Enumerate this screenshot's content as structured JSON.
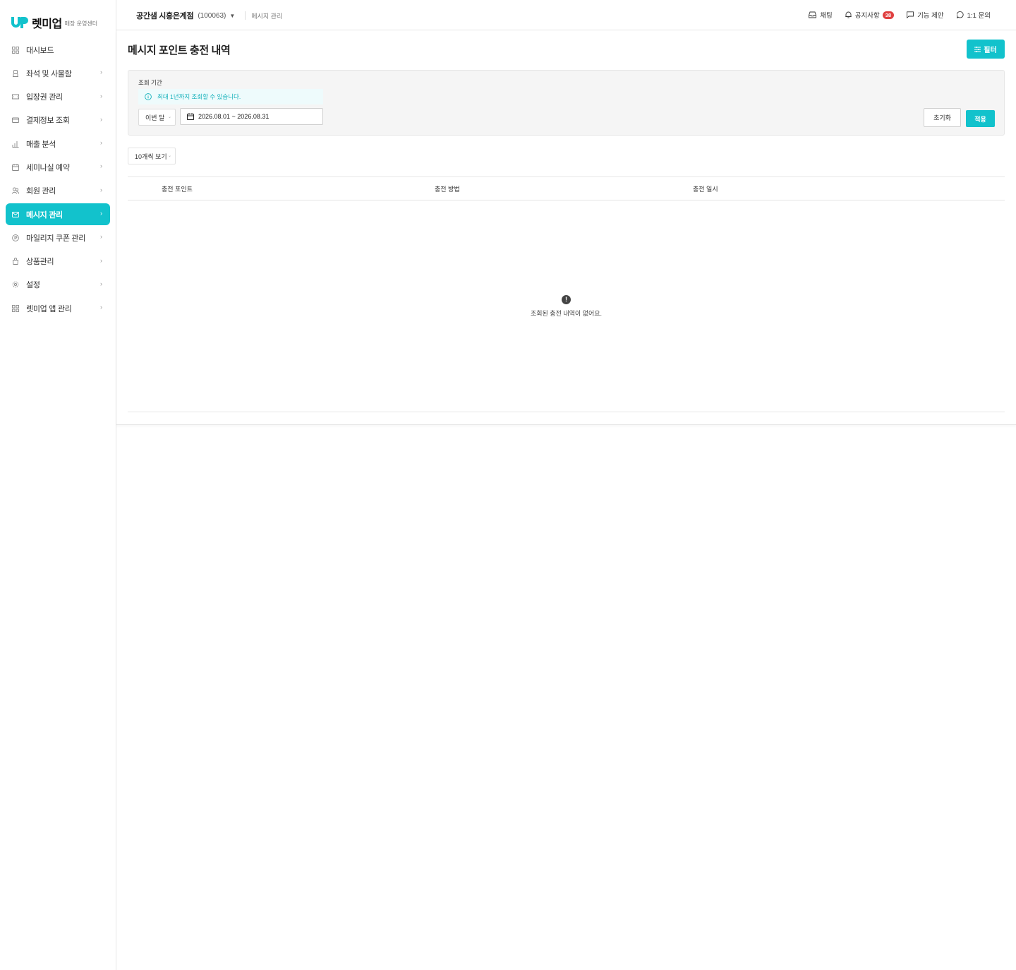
{
  "brand": {
    "name": "렛미업",
    "subtitle": "매장 운영센터",
    "accent_color": "#12c2cc"
  },
  "sidebar": {
    "items": [
      {
        "label": "대시보드",
        "icon": "grid-icon",
        "has_chevron": false
      },
      {
        "label": "좌석 및 사물함",
        "icon": "seat-icon",
        "has_chevron": true
      },
      {
        "label": "입장권 관리",
        "icon": "ticket-icon",
        "has_chevron": true
      },
      {
        "label": "결제정보 조회",
        "icon": "card-icon",
        "has_chevron": true
      },
      {
        "label": "매출 분석",
        "icon": "bar-chart-icon",
        "has_chevron": true
      },
      {
        "label": "세미나실 예약",
        "icon": "calendar-icon",
        "has_chevron": true
      },
      {
        "label": "회원 관리",
        "icon": "users-icon",
        "has_chevron": true
      },
      {
        "label": "메시지 관리",
        "icon": "mail-icon",
        "has_chevron": true,
        "active": true
      },
      {
        "label": "마일리지 쿠폰 관리",
        "icon": "coin-icon",
        "has_chevron": true
      },
      {
        "label": "상품관리",
        "icon": "bag-icon",
        "has_chevron": true
      },
      {
        "label": "설정",
        "icon": "gear-icon",
        "has_chevron": true
      },
      {
        "label": "렛미업 앱 관리",
        "icon": "apps-icon",
        "has_chevron": true
      }
    ]
  },
  "topbar": {
    "store_name": "공간샘 시흥은계점",
    "store_code": "(100063)",
    "breadcrumb": "메시지 관리",
    "links": {
      "chat": "채팅",
      "notice": "공지사항",
      "notice_count": "38",
      "suggest": "기능 제안",
      "inquiry": "1:1 문의"
    }
  },
  "page": {
    "title": "메시지 포인트 충전 내역",
    "filter_button": "필터"
  },
  "filter": {
    "period_label": "조회 기간",
    "info": "최대 1년까지 조회할 수 있습니다.",
    "range_select": "이번 달",
    "date_range": "2026.08.01 ~ 2026.08.31",
    "reset_label": "초기화",
    "apply_label": "적용"
  },
  "list": {
    "page_size": "10개씩 보기",
    "columns": [
      "충전 포인트",
      "충전 방법",
      "충전 일시"
    ],
    "empty_message": "조회된 충전 내역이 없어요."
  }
}
